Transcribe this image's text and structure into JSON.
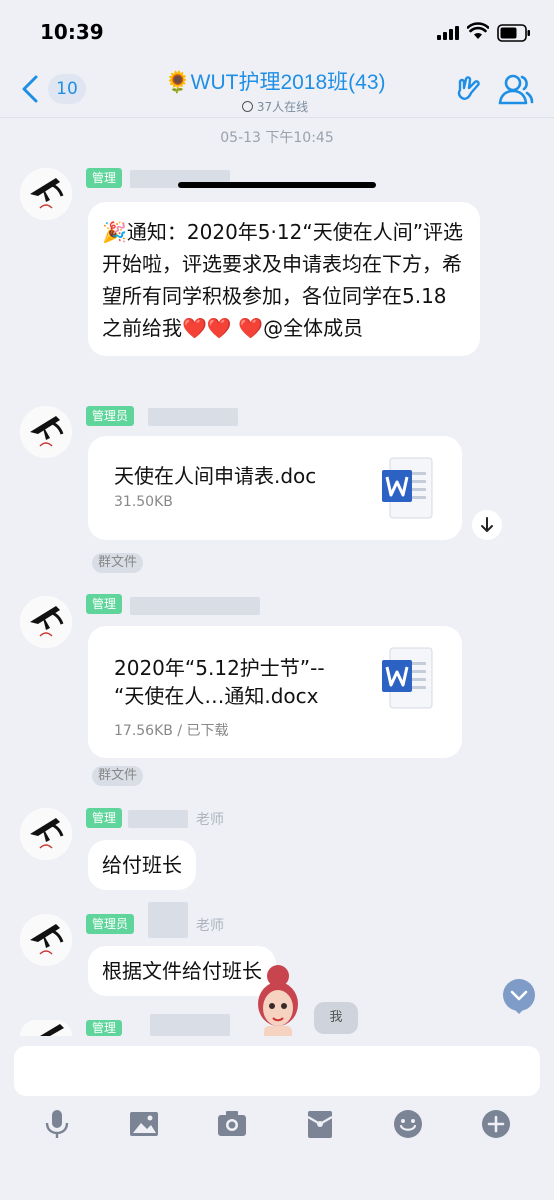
{
  "status_bar": {
    "time": "10:39"
  },
  "nav": {
    "back_count": "10",
    "title": "🌻WUT护理2018班(43)",
    "subtitle": "37人在线"
  },
  "chat": {
    "timestamp": "05-13 下午10:45",
    "messages": [
      {
        "badge": "管理",
        "text": "通知：2020年5·12“天使在人间”评选开始啦，评选要求及申请表均在下方，希望所有同学积极参加，各位同学在5.18之前给我",
        "mention": "@全体成员"
      },
      {
        "badge": "管理员",
        "file_name": "天使在人间申请表.doc",
        "file_meta": "31.50KB",
        "group_tag": "群文件"
      },
      {
        "badge": "管理",
        "file_name_line1": "2020年“5.12护士节”--",
        "file_name_line2": "“天使在人…通知.docx",
        "file_meta": "17.56KB / 已下载",
        "group_tag": "群文件"
      },
      {
        "badge": "管理",
        "sender_suffix": "老师",
        "text": "给付班长"
      },
      {
        "badge": "管理员",
        "sender_suffix": "老师",
        "text": "根据文件给付班长"
      },
      {
        "badge": "管理"
      }
    ],
    "me_label": "我"
  },
  "input": {
    "placeholder": ""
  },
  "colors": {
    "accent": "#1f8fe6",
    "badge": "#5fd59b",
    "background": "#eef0f5"
  }
}
